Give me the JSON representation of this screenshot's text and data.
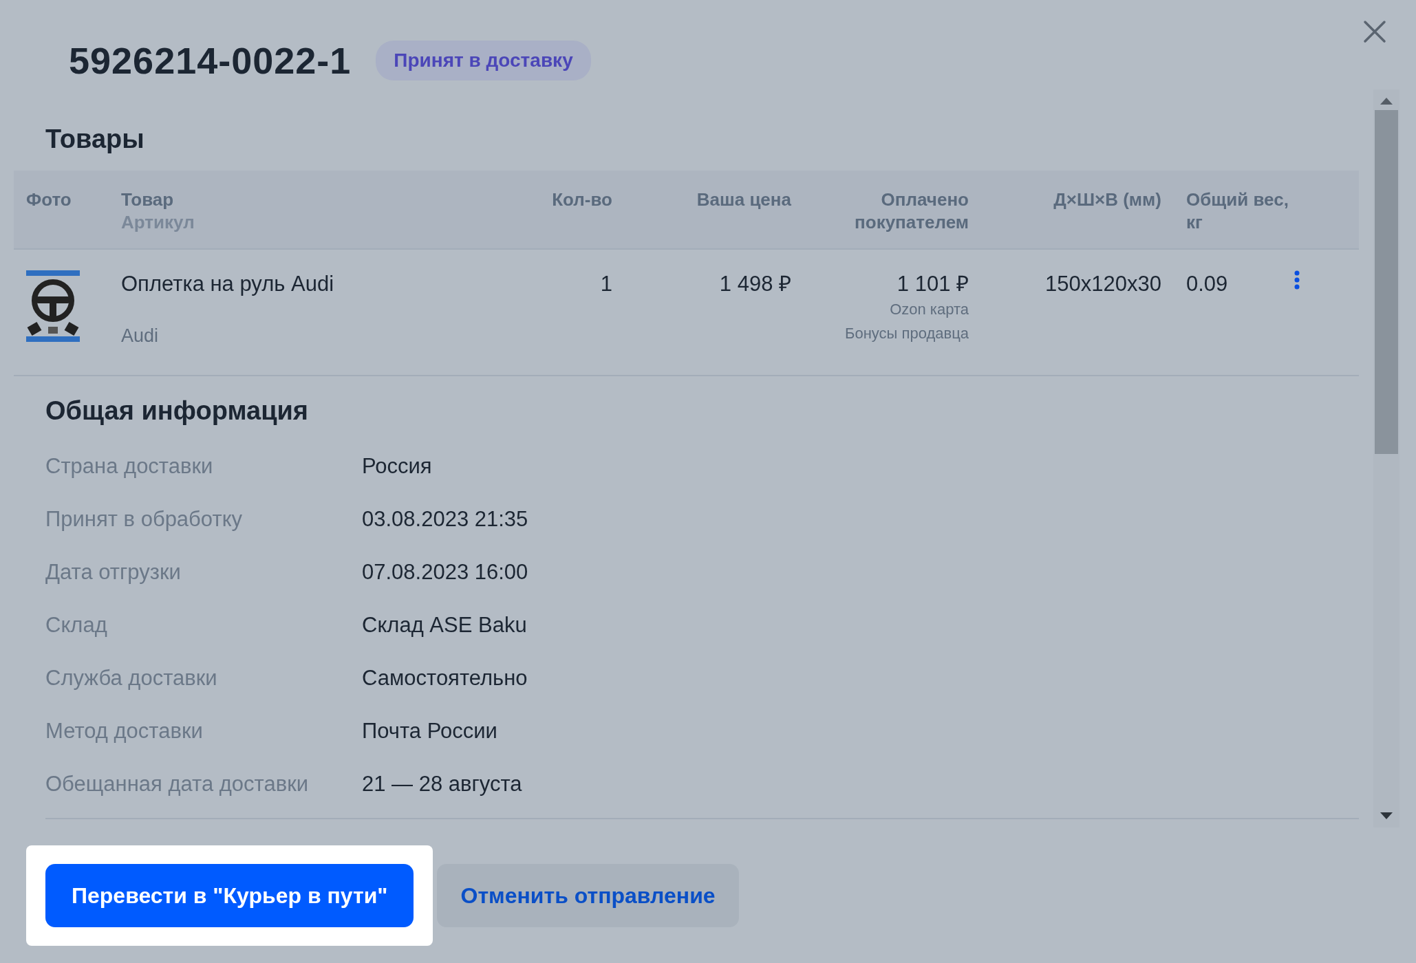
{
  "dialog": {
    "title": "5926214-0022-1",
    "status_badge": "Принят в доставку"
  },
  "products": {
    "heading": "Товары",
    "columns": [
      {
        "label": "Фото"
      },
      {
        "label": "Товар",
        "sublabel": "Артикул"
      },
      {
        "label": "Кол-во"
      },
      {
        "label": "Ваша цена"
      },
      {
        "label": "Оплачено покупателем"
      },
      {
        "label": "Д×Ш×В (мм)"
      },
      {
        "label": "Общий вес, кг"
      }
    ],
    "rows": [
      {
        "name": "Оплетка на руль Audi",
        "article": "Audi",
        "quantity": "1",
        "your_price": "1 498 ₽",
        "paid_by_buyer": "1 101 ₽",
        "payment_notes": [
          "Ozon карта",
          "Бонусы продавца"
        ],
        "dimensions": "150x120x30",
        "weight": "0.09"
      }
    ]
  },
  "general_info": {
    "heading": "Общая информация",
    "fields": [
      {
        "label": "Страна доставки",
        "value": "Россия"
      },
      {
        "label": "Принят в обработку",
        "value": "03.08.2023 21:35"
      },
      {
        "label": "Дата отгрузки",
        "value": "07.08.2023 16:00"
      },
      {
        "label": "Склад",
        "value": "Склад ASE Baku"
      },
      {
        "label": "Служба доставки",
        "value": "Самостоятельно"
      },
      {
        "label": "Метод доставки",
        "value": "Почта России"
      },
      {
        "label": "Обещанная дата доставки",
        "value": "21 — 28 августа"
      }
    ]
  },
  "actions": [
    {
      "label": "Перевести в \"Курьер в пути\"",
      "kind": "primary",
      "highlighted": true
    },
    {
      "label": "Отменить отправление",
      "kind": "secondary",
      "highlighted": false
    }
  ]
}
